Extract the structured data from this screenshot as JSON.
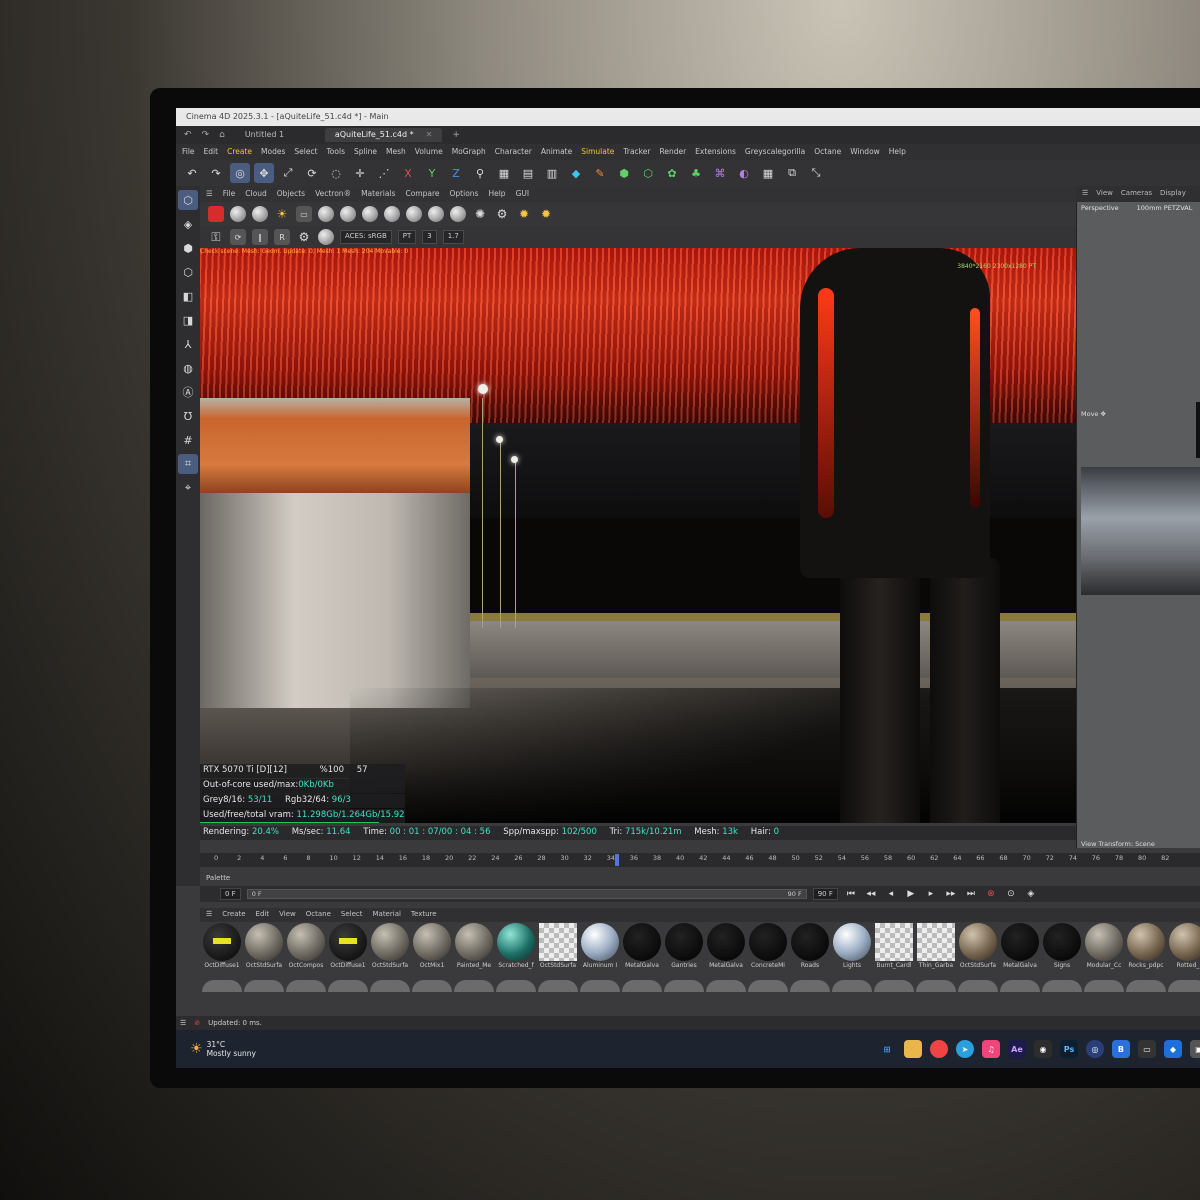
{
  "window": {
    "title": "Cinema 4D 2025.3.1 - [aQuiteLife_51.c4d *] - Main",
    "tabs": [
      {
        "label": "Untitled 1",
        "active": false
      },
      {
        "label": "aQuiteLife_51.c4d *",
        "active": true
      }
    ]
  },
  "menu": [
    "File",
    "Edit",
    "Create",
    "Modes",
    "Select",
    "Tools",
    "Spline",
    "Mesh",
    "Volume",
    "MoGraph",
    "Character",
    "Animate",
    "Simulate",
    "Tracker",
    "Render",
    "Extensions",
    "Greyscalegorilla",
    "Octane",
    "Window",
    "Help"
  ],
  "toolbar_icons": [
    "undo-icon",
    "redo-icon",
    "live-selection-icon",
    "move-icon",
    "scale-icon",
    "rotate-icon",
    "x-axis-icon",
    "y-axis-icon",
    "z-axis-icon",
    "render-icon"
  ],
  "octane_viewer": {
    "menu": [
      "File",
      "Cloud",
      "Objects",
      "Vectron®",
      "Materials",
      "Compare",
      "Options",
      "Help",
      "GUI"
    ],
    "color_space": "ACES: sRGB",
    "mode": "PT",
    "value_a": "3",
    "value_b": "1.7",
    "info_line": "Check scene: Mesh: Geom. Update: 0; Mesh: 1 Mesh: 204 Movable: 0",
    "resolution": "3840*2160 2300x1280 PT"
  },
  "render_stats": {
    "gpu": "RTX 5070 Ti [D][12]",
    "percent": "%100",
    "temp": "57",
    "ooc_label": "Out-of-core used/max:",
    "ooc_value": "0Kb/0Kb",
    "grey_label": "Grey8/16:",
    "grey_value": "53/11",
    "rgb_label": "Rgb32/64:",
    "rgb_value": "96/3",
    "vram_label": "Used/free/total vram:",
    "vram_value": "11.298Gb/1.264Gb/15.92",
    "rendering_label": "Rendering:",
    "rendering_value": "20.4%",
    "ms_label": "Ms/sec:",
    "ms_value": "11.64",
    "time_label": "Time:",
    "time_value": "00 : 01 : 07/00 : 04 : 56",
    "spp_label": "Spp/maxspp:",
    "spp_value": "102/500",
    "tri_label": "Tri:",
    "tri_value": "715k/10.21m",
    "mesh_label": "Mesh:",
    "mesh_value": "13k",
    "hair_label": "Hair:",
    "hair_value": "0",
    "progress_fraction": 0.204
  },
  "right_panel": {
    "menu": [
      "View",
      "Cameras",
      "Display"
    ],
    "view_name": "Perspective",
    "camera": "100mm PETZVAL",
    "move_label": "Move",
    "view_transform": "View Transform: Scene"
  },
  "timeline": {
    "ticks": [
      "0",
      "2",
      "4",
      "6",
      "8",
      "10",
      "12",
      "14",
      "16",
      "18",
      "20",
      "22",
      "24",
      "26",
      "28",
      "30",
      "32",
      "34",
      "36",
      "38",
      "40",
      "42",
      "44",
      "46",
      "48",
      "50",
      "52",
      "54",
      "56",
      "58",
      "60",
      "62",
      "64",
      "66",
      "68",
      "70",
      "72",
      "74",
      "76",
      "78",
      "80",
      "82"
    ],
    "current_frame": "34",
    "palette_label": "Palette",
    "start_field": "0 F",
    "slider_start": "0 F",
    "slider_end": "90 F",
    "end_field": "90 F"
  },
  "material_manager": {
    "menu": [
      "Create",
      "Edit",
      "View",
      "Octane",
      "Select",
      "Material",
      "Texture"
    ],
    "materials": [
      {
        "name": "OctDiffuse1",
        "style": "label"
      },
      {
        "name": "OctStdSurfa",
        "style": "grey"
      },
      {
        "name": "OctCompos",
        "style": "grey"
      },
      {
        "name": "OctDiffuse1",
        "style": "label"
      },
      {
        "name": "OctStdSurfa",
        "style": "grey"
      },
      {
        "name": "OctMix1",
        "style": "grey"
      },
      {
        "name": "Painted_Me",
        "style": "grey"
      },
      {
        "name": "Scratched_f",
        "style": "teal"
      },
      {
        "name": "OctStdSurfa",
        "style": "checker"
      },
      {
        "name": "Aluminum I",
        "style": "glass"
      },
      {
        "name": "MetalGalva",
        "style": "black"
      },
      {
        "name": "Gantries",
        "style": "black"
      },
      {
        "name": "MetalGalva",
        "style": "black"
      },
      {
        "name": "ConcreteMi",
        "style": "black"
      },
      {
        "name": "Roads",
        "style": "black"
      },
      {
        "name": "Lights",
        "style": "glass"
      },
      {
        "name": "Burnt_Cardl",
        "style": "checker"
      },
      {
        "name": "Thin_Garba",
        "style": "checker"
      },
      {
        "name": "OctStdSurfa",
        "style": "rock"
      },
      {
        "name": "MetalGalva",
        "style": "black"
      },
      {
        "name": "Signs",
        "style": "black"
      },
      {
        "name": "Modular_Cc",
        "style": "grey"
      },
      {
        "name": "Rocks_pdpc",
        "style": "rock"
      },
      {
        "name": "Rotted_",
        "style": "rock"
      }
    ]
  },
  "status": {
    "text": "Updated: 0 ms."
  },
  "taskbar": {
    "weather_temp": "31°C",
    "weather_desc": "Mostly sunny",
    "apps": [
      "windows-start",
      "file-explorer",
      "chrome",
      "telegram",
      "music",
      "after-effects",
      "davinci",
      "photoshop",
      "cinema4d",
      "blender",
      "terminal",
      "remote",
      "drive"
    ]
  }
}
